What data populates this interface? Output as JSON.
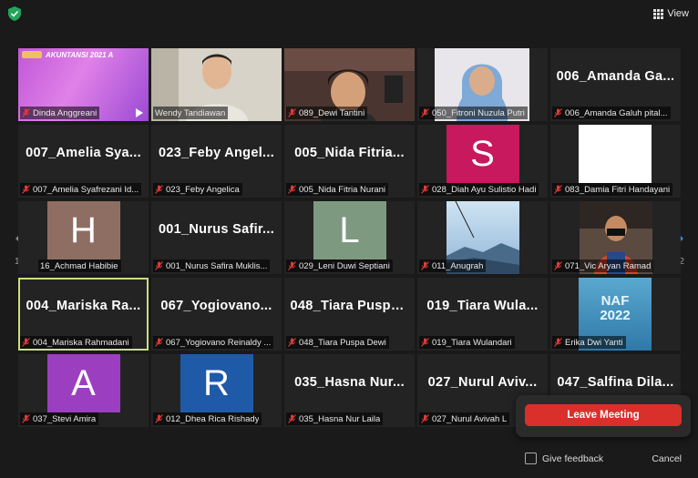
{
  "toolbar": {
    "view_label": "View"
  },
  "pagination": {
    "left": "1/2",
    "right": "1/2"
  },
  "tiles": [
    {
      "name": "Dinda Anggreani",
      "banner": "AKUNTANSI 2021 A"
    },
    {
      "name": "Wendy Tandiawan"
    },
    {
      "name": "089_Dewi Tantini"
    },
    {
      "name": "050_Fitroni Nuzula Putri"
    },
    {
      "name": "006_Amanda Galuh pital...",
      "big": "006_Amanda Ga..."
    },
    {
      "name": "007_Amelia Syafrezani Id...",
      "big": "007_Amelia Sya..."
    },
    {
      "name": "023_Feby Angelica",
      "big": "023_Feby Angel..."
    },
    {
      "name": "005_Nida Fitria Nurani",
      "big": "005_Nida Fitria..."
    },
    {
      "name": "028_Diah Ayu Sulistio Hadi",
      "letter": "S",
      "color": "#c8185e"
    },
    {
      "name": "083_Damia Fitri Handayani"
    },
    {
      "name": "16_Achmad Habibie",
      "letter": "H",
      "color": "#8e6e62"
    },
    {
      "name": "001_Nurus Safira Muklis...",
      "big": "001_Nurus Safir..."
    },
    {
      "name": "029_Leni Duwi Septiani",
      "letter": "L",
      "color": "#7d9a80"
    },
    {
      "name": "011_Anugrah"
    },
    {
      "name": "071_Vic Aryan Ramad"
    },
    {
      "name": "004_Mariska Rahmadani",
      "big": "004_Mariska Ra..."
    },
    {
      "name": "067_Yogiovano Reinaldy ...",
      "big": "067_Yogiovano..."
    },
    {
      "name": "048_Tiara Puspa Dewi",
      "big": "048_Tiara Puspa..."
    },
    {
      "name": "019_Tiara Wulandari",
      "big": "019_Tiara Wula..."
    },
    {
      "name": "Erika Dwi Yanti",
      "banner": "NAF 2022"
    },
    {
      "name": "037_Stevi Amira",
      "letter": "A",
      "color": "#9b3fc0"
    },
    {
      "name": "012_Dhea Rica Rishady",
      "letter": "R",
      "color": "#1f5aa8"
    },
    {
      "name": "035_Hasna Nur Laila",
      "big": "035_Hasna Nur..."
    },
    {
      "name": "027_Nurul Avivah L",
      "big": "027_Nurul Aviv..."
    },
    {
      "name": "",
      "big": "047_Salfina Dila..."
    }
  ],
  "leave": {
    "label": "Leave Meeting"
  },
  "feedback": {
    "label": "Give feedback"
  },
  "cancel": {
    "label": "Cancel"
  },
  "colors": {
    "leave": "#d9302b",
    "active_border": "#c7e07a",
    "accent_arrow": "#1e90ff"
  }
}
